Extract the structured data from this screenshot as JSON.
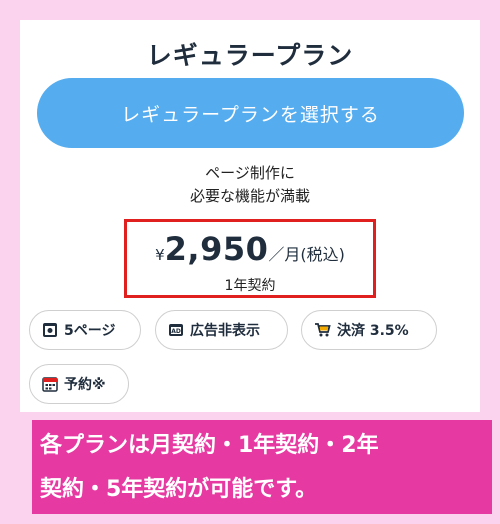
{
  "plan": {
    "title": "レギュラープラン",
    "select_button": "レギュラープランを選択する",
    "description_line1": "ページ制作に",
    "description_line2": "必要な機能が満載",
    "price": {
      "currency": "¥",
      "amount": "2,950",
      "unit": "／月(税込)",
      "contract": "1年契約"
    },
    "features": [
      {
        "label": "5ページ",
        "icon": "page-count-icon"
      },
      {
        "label": "広告非表示",
        "icon": "ad-free-icon"
      },
      {
        "label": "決済 3.5%",
        "icon": "cart-icon"
      },
      {
        "label": "予約※",
        "icon": "calendar-icon"
      }
    ]
  },
  "caption": {
    "line1": "各プランは月契約・1年契約・2年",
    "line2": "契約・5年契約が可能です。"
  },
  "colors": {
    "page_background": "#fcd3ee",
    "button": "#55acee",
    "highlight_border": "#e0201f",
    "caption_background": "#e63aa2"
  }
}
